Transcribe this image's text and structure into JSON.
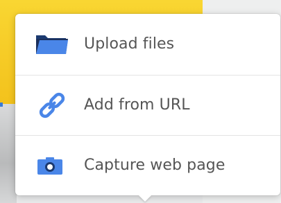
{
  "menu": {
    "items": [
      {
        "label": "Upload files",
        "icon": "folder-icon"
      },
      {
        "label": "Add from URL",
        "icon": "link-icon"
      },
      {
        "label": "Capture web page",
        "icon": "camera-icon"
      }
    ]
  },
  "colors": {
    "icon_blue": "#4a86e8",
    "folder_dark": "#1c3a70",
    "label_text": "#555555",
    "background_yellow": "#f6cc26"
  }
}
